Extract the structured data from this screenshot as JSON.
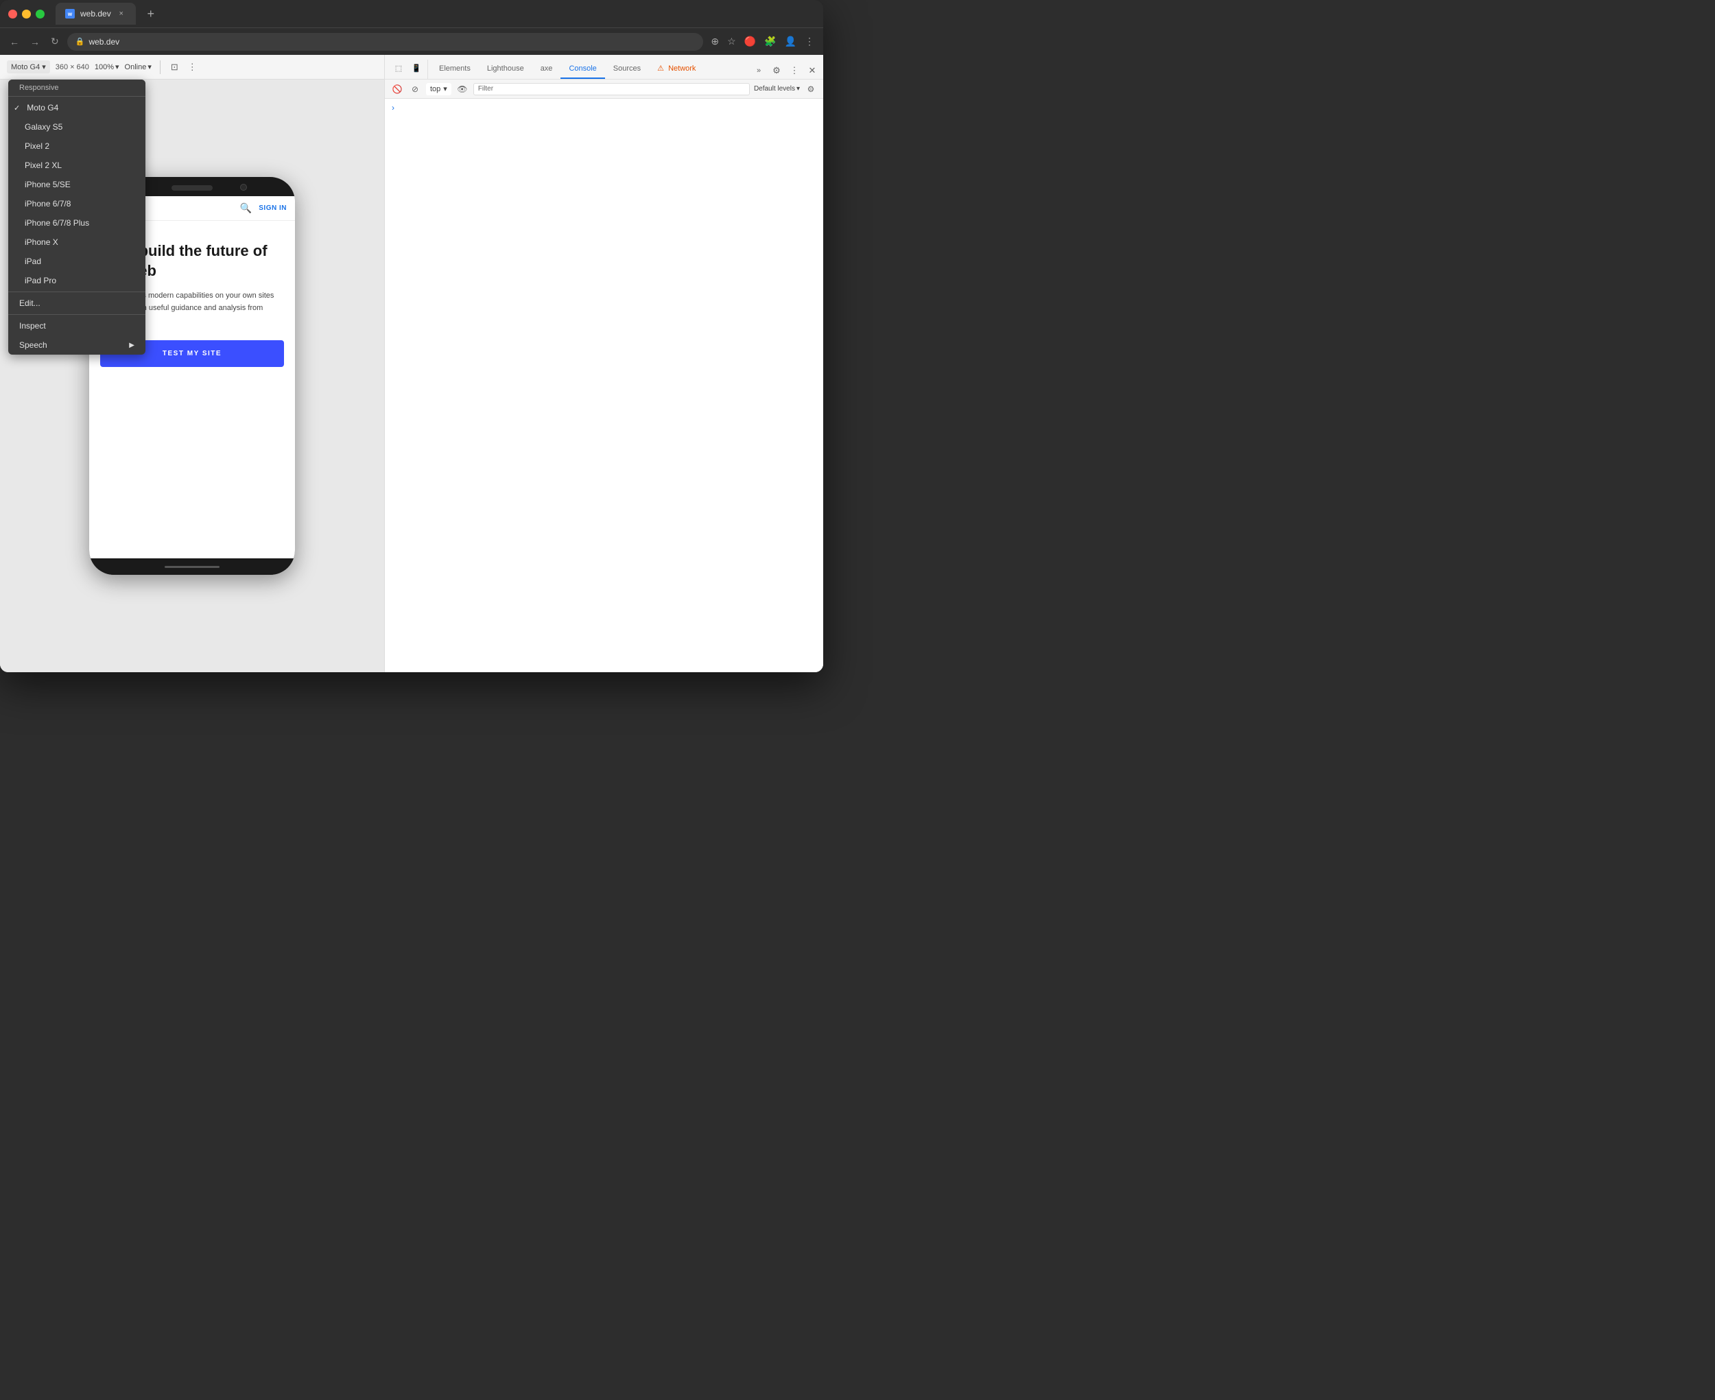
{
  "browser": {
    "title": "web.dev",
    "url": "web.dev",
    "tab_label": "web.dev",
    "tab_close": "×",
    "tab_new": "+"
  },
  "device_toolbar": {
    "device": "Moto G4",
    "width": "360",
    "separator": "×",
    "height": "640",
    "zoom": "100%",
    "online": "Online",
    "chevron": "▾"
  },
  "context_menu": {
    "header": "Responsive",
    "items": [
      {
        "label": "Moto G4",
        "checked": true
      },
      {
        "label": "Galaxy S5",
        "checked": false
      },
      {
        "label": "Pixel 2",
        "checked": false
      },
      {
        "label": "Pixel 2 XL",
        "checked": false
      },
      {
        "label": "iPhone 5/SE",
        "checked": false
      },
      {
        "label": "iPhone 6/7/8",
        "checked": false
      },
      {
        "label": "iPhone 6/7/8 Plus",
        "checked": false
      },
      {
        "label": "iPhone X",
        "checked": false
      },
      {
        "label": "iPad",
        "checked": false
      },
      {
        "label": "iPad Pro",
        "checked": false
      }
    ],
    "edit": "Edit...",
    "inspect": "Inspect",
    "speech": "Speech",
    "speech_arrow": "▶"
  },
  "phone_content": {
    "sign_in": "SIGN IN",
    "hero_title": "Let's build the future of the web",
    "hero_desc": "Get the web's modern capabilities on your own sites and apps with useful guidance and analysis from web.dev.",
    "cta_button": "TEST MY SITE"
  },
  "devtools": {
    "tabs": [
      {
        "label": "Elements",
        "active": false
      },
      {
        "label": "Lighthouse",
        "active": false
      },
      {
        "label": "axe",
        "active": false
      },
      {
        "label": "Console",
        "active": true
      },
      {
        "label": "Sources",
        "active": false
      },
      {
        "label": "⚠ Network",
        "active": false,
        "warning": true
      }
    ],
    "more_tabs": "»",
    "settings_icon": "⚙",
    "more_options": "⋮",
    "close": "✕",
    "toolbar": {
      "top_label": "top",
      "filter_placeholder": "Filter",
      "default_levels": "Default levels",
      "chevron": "▾",
      "settings": "⚙"
    },
    "console_arrow": "›"
  }
}
